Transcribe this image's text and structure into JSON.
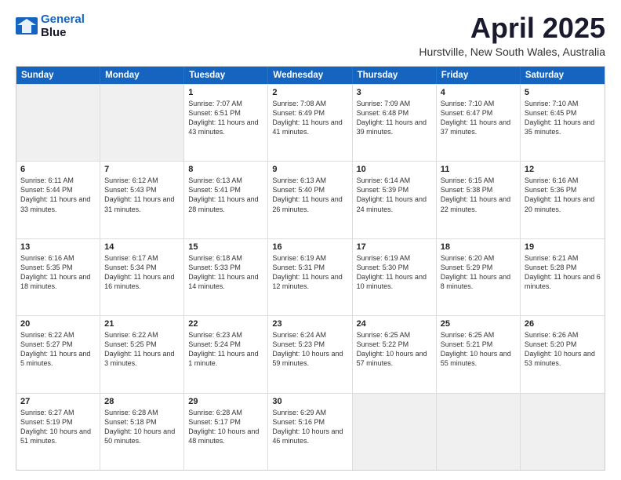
{
  "logo": {
    "line1": "General",
    "line2": "Blue"
  },
  "title": "April 2025",
  "subtitle": "Hurstville, New South Wales, Australia",
  "header_days": [
    "Sunday",
    "Monday",
    "Tuesday",
    "Wednesday",
    "Thursday",
    "Friday",
    "Saturday"
  ],
  "weeks": [
    [
      {
        "day": "",
        "text": "",
        "shaded": true
      },
      {
        "day": "",
        "text": "",
        "shaded": true
      },
      {
        "day": "1",
        "text": "Sunrise: 7:07 AM\nSunset: 6:51 PM\nDaylight: 11 hours and 43 minutes."
      },
      {
        "day": "2",
        "text": "Sunrise: 7:08 AM\nSunset: 6:49 PM\nDaylight: 11 hours and 41 minutes."
      },
      {
        "day": "3",
        "text": "Sunrise: 7:09 AM\nSunset: 6:48 PM\nDaylight: 11 hours and 39 minutes."
      },
      {
        "day": "4",
        "text": "Sunrise: 7:10 AM\nSunset: 6:47 PM\nDaylight: 11 hours and 37 minutes."
      },
      {
        "day": "5",
        "text": "Sunrise: 7:10 AM\nSunset: 6:45 PM\nDaylight: 11 hours and 35 minutes."
      }
    ],
    [
      {
        "day": "6",
        "text": "Sunrise: 6:11 AM\nSunset: 5:44 PM\nDaylight: 11 hours and 33 minutes."
      },
      {
        "day": "7",
        "text": "Sunrise: 6:12 AM\nSunset: 5:43 PM\nDaylight: 11 hours and 31 minutes."
      },
      {
        "day": "8",
        "text": "Sunrise: 6:13 AM\nSunset: 5:41 PM\nDaylight: 11 hours and 28 minutes."
      },
      {
        "day": "9",
        "text": "Sunrise: 6:13 AM\nSunset: 5:40 PM\nDaylight: 11 hours and 26 minutes."
      },
      {
        "day": "10",
        "text": "Sunrise: 6:14 AM\nSunset: 5:39 PM\nDaylight: 11 hours and 24 minutes."
      },
      {
        "day": "11",
        "text": "Sunrise: 6:15 AM\nSunset: 5:38 PM\nDaylight: 11 hours and 22 minutes."
      },
      {
        "day": "12",
        "text": "Sunrise: 6:16 AM\nSunset: 5:36 PM\nDaylight: 11 hours and 20 minutes."
      }
    ],
    [
      {
        "day": "13",
        "text": "Sunrise: 6:16 AM\nSunset: 5:35 PM\nDaylight: 11 hours and 18 minutes."
      },
      {
        "day": "14",
        "text": "Sunrise: 6:17 AM\nSunset: 5:34 PM\nDaylight: 11 hours and 16 minutes."
      },
      {
        "day": "15",
        "text": "Sunrise: 6:18 AM\nSunset: 5:33 PM\nDaylight: 11 hours and 14 minutes."
      },
      {
        "day": "16",
        "text": "Sunrise: 6:19 AM\nSunset: 5:31 PM\nDaylight: 11 hours and 12 minutes."
      },
      {
        "day": "17",
        "text": "Sunrise: 6:19 AM\nSunset: 5:30 PM\nDaylight: 11 hours and 10 minutes."
      },
      {
        "day": "18",
        "text": "Sunrise: 6:20 AM\nSunset: 5:29 PM\nDaylight: 11 hours and 8 minutes."
      },
      {
        "day": "19",
        "text": "Sunrise: 6:21 AM\nSunset: 5:28 PM\nDaylight: 11 hours and 6 minutes."
      }
    ],
    [
      {
        "day": "20",
        "text": "Sunrise: 6:22 AM\nSunset: 5:27 PM\nDaylight: 11 hours and 5 minutes."
      },
      {
        "day": "21",
        "text": "Sunrise: 6:22 AM\nSunset: 5:25 PM\nDaylight: 11 hours and 3 minutes."
      },
      {
        "day": "22",
        "text": "Sunrise: 6:23 AM\nSunset: 5:24 PM\nDaylight: 11 hours and 1 minute."
      },
      {
        "day": "23",
        "text": "Sunrise: 6:24 AM\nSunset: 5:23 PM\nDaylight: 10 hours and 59 minutes."
      },
      {
        "day": "24",
        "text": "Sunrise: 6:25 AM\nSunset: 5:22 PM\nDaylight: 10 hours and 57 minutes."
      },
      {
        "day": "25",
        "text": "Sunrise: 6:25 AM\nSunset: 5:21 PM\nDaylight: 10 hours and 55 minutes."
      },
      {
        "day": "26",
        "text": "Sunrise: 6:26 AM\nSunset: 5:20 PM\nDaylight: 10 hours and 53 minutes."
      }
    ],
    [
      {
        "day": "27",
        "text": "Sunrise: 6:27 AM\nSunset: 5:19 PM\nDaylight: 10 hours and 51 minutes."
      },
      {
        "day": "28",
        "text": "Sunrise: 6:28 AM\nSunset: 5:18 PM\nDaylight: 10 hours and 50 minutes."
      },
      {
        "day": "29",
        "text": "Sunrise: 6:28 AM\nSunset: 5:17 PM\nDaylight: 10 hours and 48 minutes."
      },
      {
        "day": "30",
        "text": "Sunrise: 6:29 AM\nSunset: 5:16 PM\nDaylight: 10 hours and 46 minutes."
      },
      {
        "day": "",
        "text": "",
        "shaded": true
      },
      {
        "day": "",
        "text": "",
        "shaded": true
      },
      {
        "day": "",
        "text": "",
        "shaded": true
      }
    ]
  ]
}
